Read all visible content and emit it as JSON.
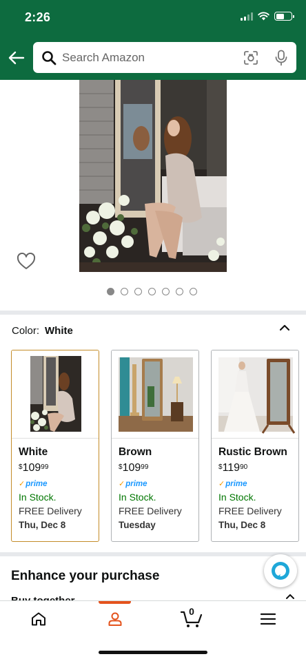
{
  "status_bar": {
    "time": "2:26"
  },
  "header": {
    "search_placeholder": "Search Amazon"
  },
  "gallery": {
    "image_count": 7,
    "active_index": 0
  },
  "color_section": {
    "label": "Color:",
    "selected": "White",
    "options": [
      {
        "name": "White",
        "price_whole": "109",
        "price_frac": "99",
        "prime": "prime",
        "stock": "In Stock.",
        "delivery": "FREE Delivery",
        "date": "Thu, Dec 8",
        "selected": true
      },
      {
        "name": "Brown",
        "price_whole": "109",
        "price_frac": "99",
        "prime": "prime",
        "stock": "In Stock.",
        "delivery": "FREE Delivery",
        "date": "Tuesday",
        "selected": false
      },
      {
        "name": "Rustic Brown",
        "price_whole": "119",
        "price_frac": "90",
        "prime": "prime",
        "stock": "In Stock.",
        "delivery": "FREE Delivery",
        "date": "Thu, Dec 8",
        "selected": false
      }
    ]
  },
  "currency_symbol": "$",
  "enhance": {
    "title": "Enhance your purchase",
    "partial_row": "Buy together"
  },
  "bottom_nav": {
    "cart_count": "0",
    "active": "account"
  },
  "colors": {
    "header_bg": "#0d6b3f",
    "accent": "#e4531d",
    "in_stock": "#007600",
    "prime": "#1a98ff",
    "selected_border": "#c38b27"
  }
}
